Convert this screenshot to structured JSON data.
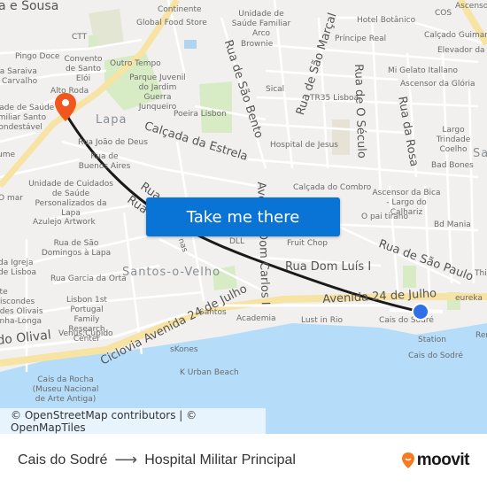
{
  "map": {
    "labels": {
      "sousa": "a e Sousa",
      "continente": "Continente",
      "global_food": "Global Food Store",
      "usf_arco": "Unidade de Saúde Familiar Arco",
      "brownie": "Brownie",
      "ctt": "CTT",
      "pingo_doce": "Pingo Doce",
      "convento": "Convento de Santo Elói",
      "outro_tempo": "Outro Tempo",
      "parque_juvenil": "Parque Juvenil do Jardim Guerra Junqueiro",
      "rua_saraiva": "Rua Saraiva de Carvalho",
      "alto_roda": "Alto Roda",
      "usf_santo": "Unidade de Saúde Familiar Santo Condestável",
      "lapa": "Lapa",
      "poeira": "Poeira Lisbon",
      "calcada_estrela": "Calçada da Estrela",
      "rua_joao_deus": "Rua João de Deus",
      "buenos_aires": "Rua de Buenos Aires",
      "ucsp_lapa": "Unidade de Cuidados de Saúde Personalizados da Lapa",
      "azulejo": "Azulejo Artwork",
      "rua_sao_domingos": "Rua de São Domingos à Lapa",
      "igreja": "da Igreja de Lisboa",
      "garcia_orta": "Rua Garcia da Orta",
      "santos_velho": "Santos-o-Velho",
      "viscondes": "ete Viscondes ndes Olivais enha-Longa",
      "lisbon_1st": "Lisbon 1st Portugal Family Research Center",
      "venus": "Venus;Cupido",
      "olival": "do Olival",
      "ciclovia": "Ciclovia Avenida 24 de Julho",
      "santos": "Santos",
      "academia": "Academia",
      "skones": "sKones",
      "k_urban": "K Urban Beach",
      "cais_rocha": "Cais da Rocha (Museu Nacional de Arte Antiga)",
      "lust_rio": "Lust in Rio",
      "cais_sodre_1": "Cais do Sodré",
      "station": "Station",
      "cais_sodre_2": "Cais do Sodré",
      "eureka": "eureka",
      "av_24_julho": "Avenida 24 de Julho",
      "rua_dom_luis": "Rua Dom Luís I",
      "rua_sao_paulo": "Rua de São Paulo",
      "fruit_chop": "Fruit Chop",
      "dll": "DLL",
      "o_pai_tirano": "O pai tirano",
      "bd_mania": "Bd Mania",
      "ascensor_bica": "Ascensor da Bica - Largo do Calhariz",
      "calcada_combro": "Calçada do Combro",
      "bad_bones": "Bad Bones",
      "largo_trindade": "Largo Trindade Coelho",
      "rua_rosa": "Rua da Rosa",
      "rua_seculo": "Rua de O Século",
      "ascensor_gloria": "Ascensor da Glória",
      "mi_gelato": "Mi Gelato Itallano",
      "tr35": "TR35 Lisboa",
      "sical": "Sical",
      "hospital_jesus": "Hospital de Jesus",
      "rua_sao_marcal": "Rua de São Marçal",
      "rua_sao_bento": "Rua de São Bento",
      "principe_real": "Príncipe Real",
      "hotel_botanico": "Hotel Botânico",
      "cos": "COS",
      "ascensor": "Ascensor",
      "calcado_guimaraes": "Calçado Guimarães",
      "elevador": "Elevador da G",
      "av_dom_carlos": "Avenida Dom Carlos I",
      "rua_1": "Rua",
      "rua_2": "Rua",
      "rua_ss": "nas",
      "this": "This",
      "ren": "Ren",
      "ume": "ume",
      "omar": "O mar",
      "sa": "Sa",
      "santos_sa": "Sa"
    },
    "cta_label": "Take me there",
    "attribution": "© OpenStreetMap contributors | © OpenMapTiles",
    "destination_marker_color": "#f0561d",
    "origin_marker_color": "#2f6fe8",
    "route_color": "#1a1a1a",
    "water_color": "#b5dcf8",
    "major_road_color": "#f7e3a3"
  },
  "footer": {
    "origin": "Cais do Sodré",
    "destination": "Hospital Militar Principal",
    "arrow": "⟶",
    "brand": "moovit",
    "brand_color": "#f47b20"
  }
}
